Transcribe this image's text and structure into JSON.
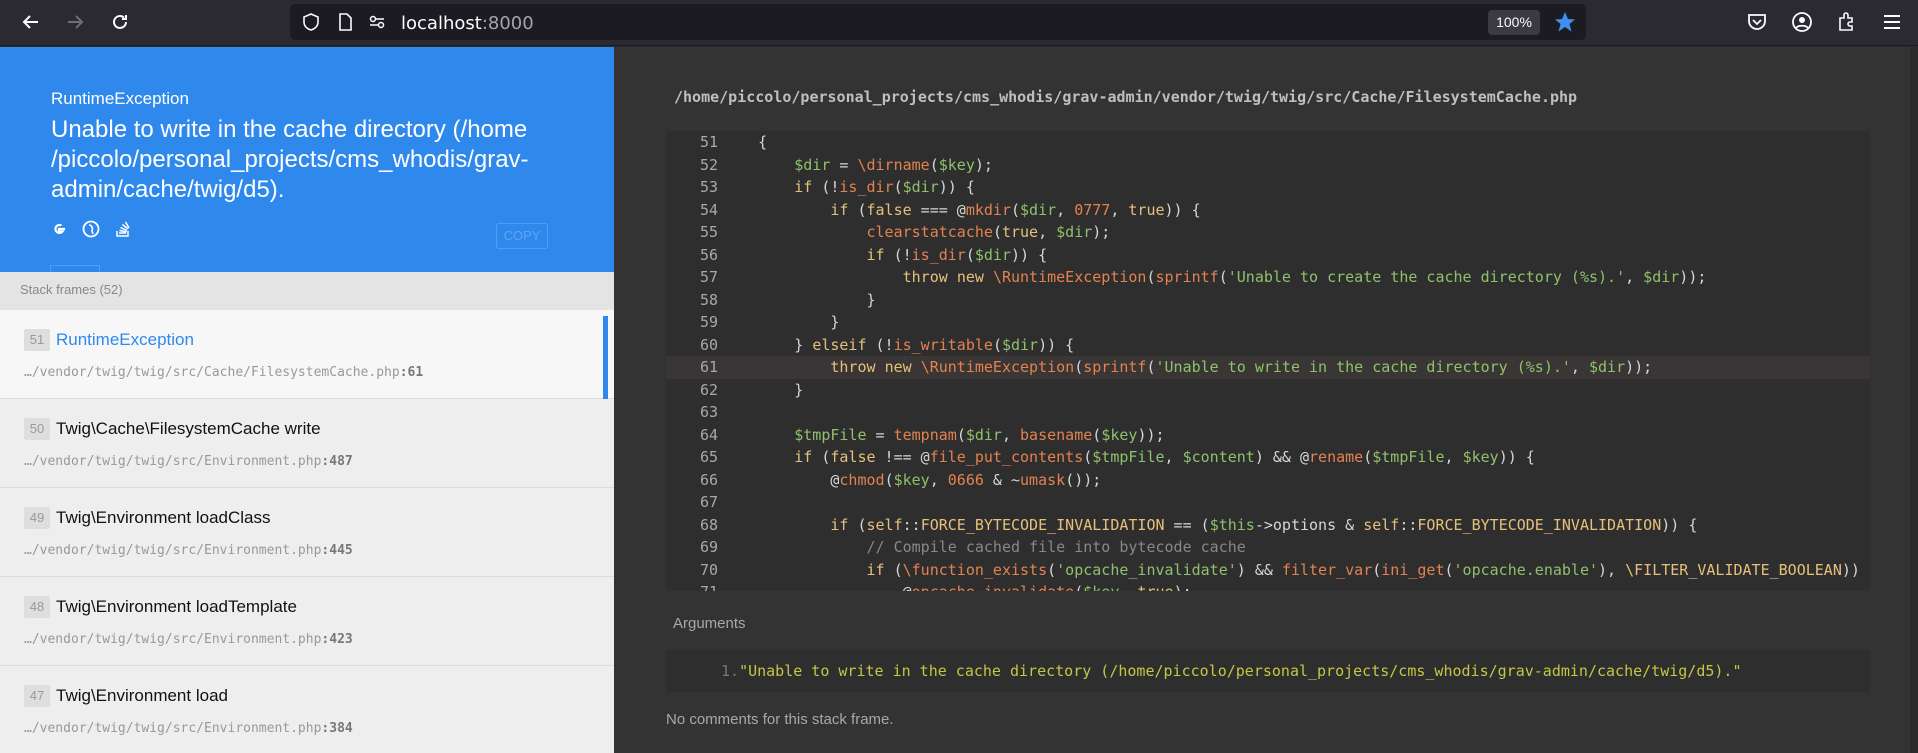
{
  "browser": {
    "url_host": "localhost",
    "url_port": ":8000",
    "zoom": "100%"
  },
  "exception": {
    "class": "RuntimeException",
    "message": "Unable to write in the cache directory (/home /piccolo/personal_projects/cms_whodis/grav- admin/cache/twig/d5).",
    "copy_label": "COPY"
  },
  "frames_label": "Stack frames (52)",
  "frames": [
    {
      "num": "51",
      "title": "RuntimeException",
      "file": "…/vendor/twig/twig/src/Cache/FilesystemCache.php",
      "line": ":61"
    },
    {
      "num": "50",
      "title": "Twig\\Cache\\FilesystemCache write",
      "file": "…/vendor/twig/twig/src/Environment.php",
      "line": ":487"
    },
    {
      "num": "49",
      "title": "Twig\\Environment loadClass",
      "file": "…/vendor/twig/twig/src/Environment.php",
      "line": ":445"
    },
    {
      "num": "48",
      "title": "Twig\\Environment loadTemplate",
      "file": "…/vendor/twig/twig/src/Environment.php",
      "line": ":423"
    },
    {
      "num": "47",
      "title": "Twig\\Environment load",
      "file": "…/vendor/twig/twig/src/Environment.php",
      "line": ":384"
    }
  ],
  "file_path": "/home/piccolo/personal_projects/cms_whodis/grav-admin/vendor/twig/twig/src/Cache/FilesystemCache.php",
  "code_lines": [
    {
      "n": "51",
      "code": "    {"
    },
    {
      "n": "52",
      "code": "        $dir = \\dirname($key);"
    },
    {
      "n": "53",
      "code": "        if (!is_dir($dir)) {"
    },
    {
      "n": "54",
      "code": "            if (false === @mkdir($dir, 0777, true)) {"
    },
    {
      "n": "55",
      "code": "                clearstatcache(true, $dir);"
    },
    {
      "n": "56",
      "code": "                if (!is_dir($dir)) {"
    },
    {
      "n": "57",
      "code": "                    throw new \\RuntimeException(sprintf('Unable to create the cache directory (%s).', $dir));"
    },
    {
      "n": "58",
      "code": "                }"
    },
    {
      "n": "59",
      "code": "            }"
    },
    {
      "n": "60",
      "code": "        } elseif (!is_writable($dir)) {"
    },
    {
      "n": "61",
      "code": "            throw new \\RuntimeException(sprintf('Unable to write in the cache directory (%s).', $dir));"
    },
    {
      "n": "62",
      "code": "        }"
    },
    {
      "n": "63",
      "code": ""
    },
    {
      "n": "64",
      "code": "        $tmpFile = tempnam($dir, basename($key));"
    },
    {
      "n": "65",
      "code": "        if (false !== @file_put_contents($tmpFile, $content) && @rename($tmpFile, $key)) {"
    },
    {
      "n": "66",
      "code": "            @chmod($key, 0666 & ~umask());"
    },
    {
      "n": "67",
      "code": ""
    },
    {
      "n": "68",
      "code": "            if (self::FORCE_BYTECODE_INVALIDATION == ($this->options & self::FORCE_BYTECODE_INVALIDATION)) {"
    },
    {
      "n": "69",
      "code": "                // Compile cached file into bytecode cache"
    },
    {
      "n": "70",
      "code": "                if (\\function_exists('opcache_invalidate') && filter_var(ini_get('opcache.enable'), \\FILTER_VALIDATE_BOOLEAN)) {"
    },
    {
      "n": "71",
      "code": "                    @opcache_invalidate($key, true);"
    }
  ],
  "highlight_line": "61",
  "arguments_label": "Arguments",
  "argument": {
    "index": "1.",
    "value": "\"Unable to write in the cache directory (/home/piccolo/personal_projects/cms_whodis/grav-admin/cache/twig/d5).\""
  },
  "no_comments": "No comments for this stack frame.",
  "colors": {
    "accent": "#2f89ec",
    "editor_bg": "#333333"
  }
}
